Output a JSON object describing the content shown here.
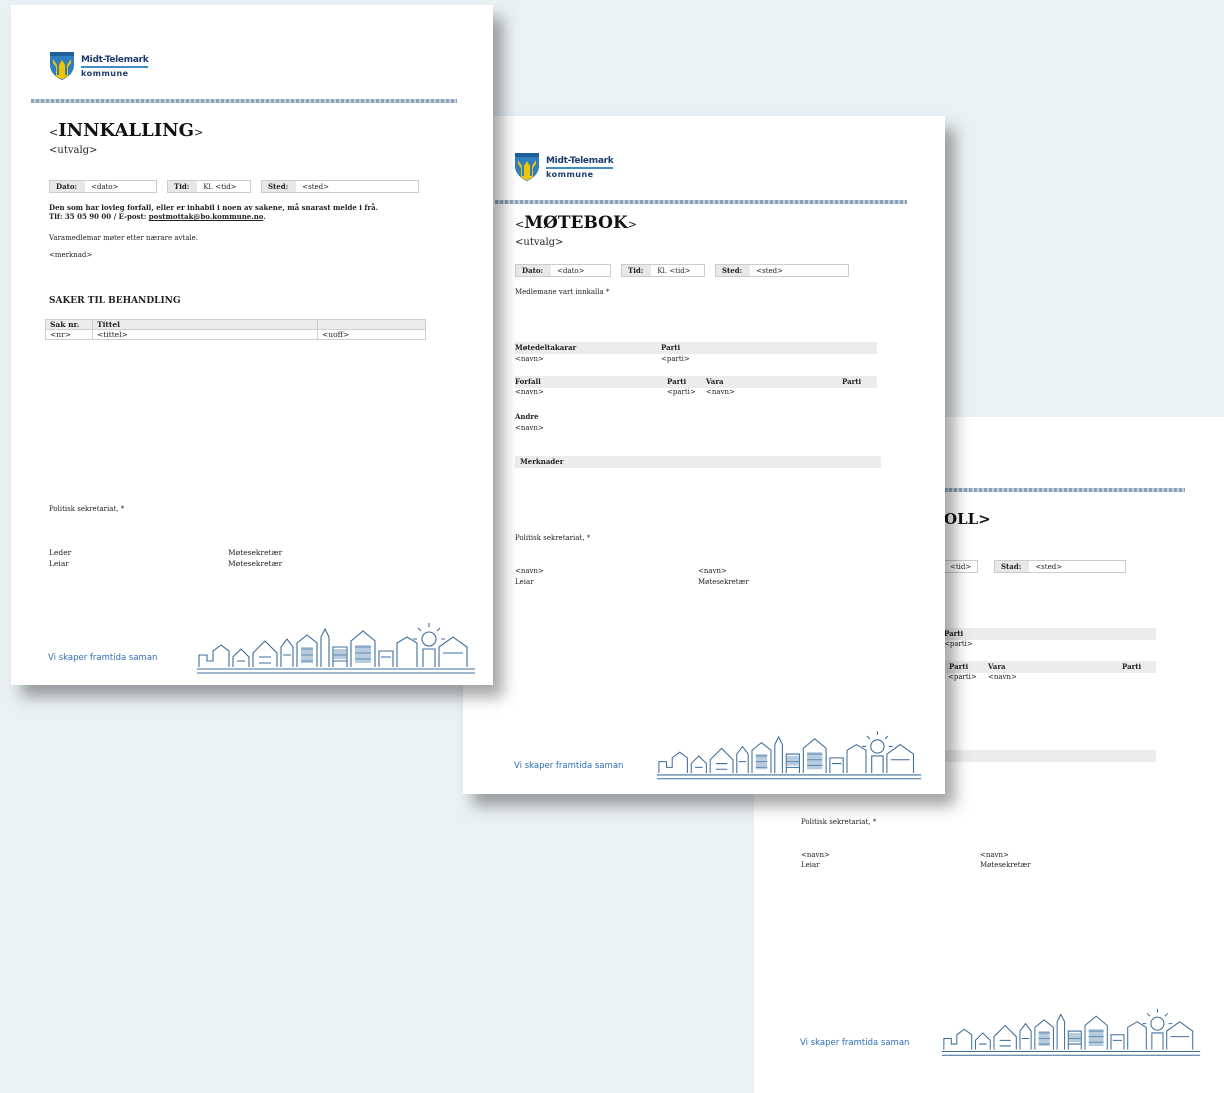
{
  "common": {
    "logo_line1": "Midt-Telemark",
    "logo_line2": "kommune",
    "slogan": "Vi skaper framtida saman",
    "politisk": "Politisk sekretariat, *",
    "navn": "<navn>",
    "parti": "<parti>",
    "leiar": "Leiar",
    "motesekretar": "Møtesekretær",
    "parti_label": "Parti",
    "vara_label": "Vara",
    "dato_label": "Dato:",
    "tid_label": "Tid:",
    "sted_label": "Sted:",
    "dato_value": "<dato>",
    "tid_value": "Kl. <tid>",
    "sted_value": "<sted>"
  },
  "innkalling": {
    "title": "INNKALLING",
    "title_bracket_open": "<",
    "title_bracket_close": ">",
    "utvalg": "<utvalg>",
    "notice_line1": "Den som har lovleg forfall, eller er inhabil i noen av sakene, må snarast melde i frå.",
    "notice_line2_prefix": "Tlf: 35 05 90 00  /  E-post: ",
    "notice_email": "postmottak@bo.kommune.no",
    "notice_line2_suffix": ".",
    "varamedlemar": "Varamedlemar møter etter nærare avtale.",
    "merknad": "<merknad>",
    "saker_heading": "SAKER TIL BEHANDLING",
    "table_headers": [
      "Sak nr.",
      "Tittel",
      ""
    ],
    "table_row": [
      "<nr>",
      "<tittel>",
      "<uoff>"
    ],
    "leder": "Leder",
    "leiar": "Leiar",
    "motesekretar1": "Møtesekretær",
    "motesekretar2": "Møtesekretær"
  },
  "motebok": {
    "title": "MØTEBOK",
    "title_bracket_open": "<",
    "title_bracket_close": ">",
    "utvalg": "<utvalg>",
    "medlemane": "Medlemane vart innkalla *",
    "motedeltakarar": "Møtedeltakarar",
    "forfall": "Forfall",
    "andre": "Andre",
    "merknader": "Merknader"
  },
  "protokoll": {
    "title_fragment": "OLL>",
    "tid_fragment": "<tid>",
    "stad_label": "Stad:",
    "stad_value": "<sted>"
  }
}
